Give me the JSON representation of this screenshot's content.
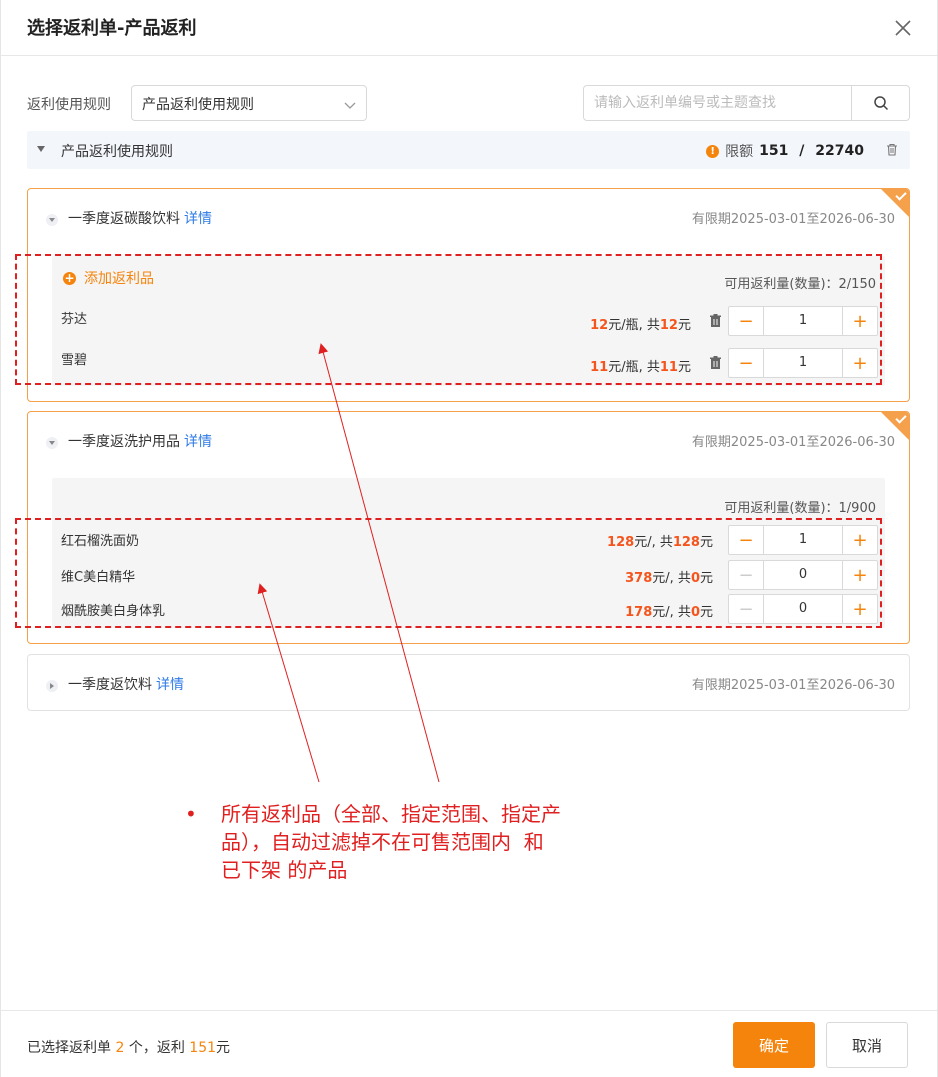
{
  "modal": {
    "title": "选择返利单-产品返利",
    "close_icon": "close-icon"
  },
  "filter": {
    "label": "返利使用规则",
    "selected": "产品返利使用规则",
    "search_placeholder": "请输入返利单编号或主题查找"
  },
  "rule_bar": {
    "title": "产品返利使用规则",
    "quota_label": "限额",
    "quota_used": "151",
    "quota_sep": " / ",
    "quota_total": "22740"
  },
  "cards": [
    {
      "title": "一季度返碳酸饮料",
      "detail": "详情",
      "date": "有限期2025-03-01至2026-06-30",
      "add_label": "添加返利品",
      "avail": "可用返利量(数量)：2/150",
      "products": [
        {
          "name": "芬达",
          "unit_price": "12",
          "unit": "元/瓶, 共",
          "total": "12",
          "total_unit": "元",
          "qty": "1"
        },
        {
          "name": "雪碧",
          "unit_price": "11",
          "unit": "元/瓶, 共",
          "total": "11",
          "total_unit": "元",
          "qty": "1"
        }
      ]
    },
    {
      "title": "一季度返洗护用品",
      "detail": "详情",
      "date": "有限期2025-03-01至2026-06-30",
      "avail": "可用返利量(数量)：1/900",
      "products": [
        {
          "name": "红石榴洗面奶",
          "unit_price": "128",
          "unit": "元/, 共",
          "total": "128",
          "total_unit": "元",
          "qty": "1"
        },
        {
          "name": "维C美白精华",
          "unit_price": "378",
          "unit": "元/, 共",
          "total": "0",
          "total_unit": "元",
          "qty": "0"
        },
        {
          "name": "烟酰胺美白身体乳",
          "unit_price": "178",
          "unit": "元/, 共",
          "total": "0",
          "total_unit": "元",
          "qty": "0"
        }
      ]
    },
    {
      "title": "一季度返饮料",
      "detail": "详情",
      "date": "有限期2025-03-01至2026-06-30"
    }
  ],
  "annotation": {
    "bullet": "•",
    "text_1": "所有返利品（全部、指定范围、指定产",
    "text_2": "品），自动过滤掉不在可售范围内  和",
    "text_3": "已下架 的产品"
  },
  "footer": {
    "prefix": "已选择返利单 ",
    "count": "2",
    "mid": " 个，返利 ",
    "amount": "151",
    "suffix": "元",
    "ok_label": "确定",
    "cancel_label": "取消"
  },
  "colors": {
    "accent": "#f5840c",
    "link": "#2e7be6",
    "price": "#f5541c",
    "annotation": "#e02020"
  }
}
